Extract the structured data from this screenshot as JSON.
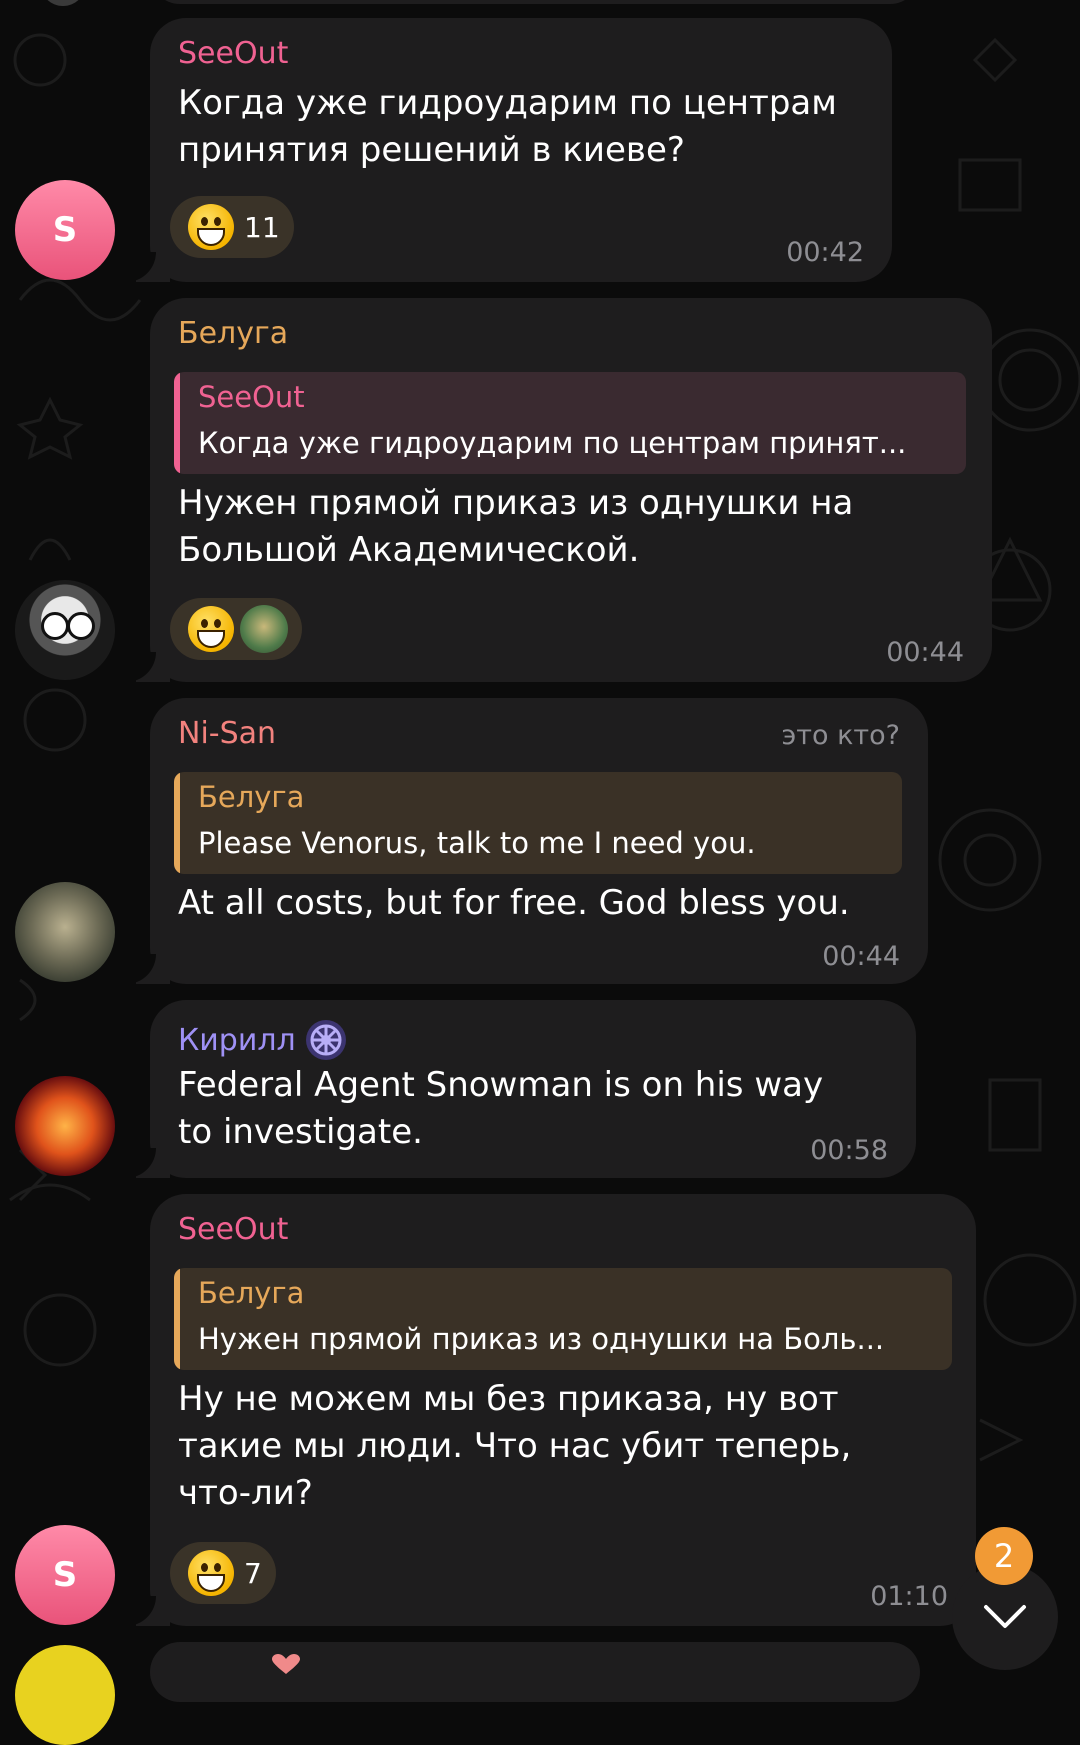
{
  "messages": [
    {
      "sender": "SeeOut",
      "sender_color": "#f06292",
      "avatar_letter": "S",
      "text_lines": [
        "Когда уже гидроударим по центрам",
        "принятия решений в киеве?"
      ],
      "reaction_count": "11",
      "time": "00:42"
    },
    {
      "sender": "Белуга",
      "sender_color": "#e6a85a",
      "reply": {
        "name": "SeeOut",
        "text": "Когда уже гидроударим по центрам принят...",
        "color": "#f06292"
      },
      "text_lines": [
        "Нужен прямой приказ из однушки на",
        "Большой Академической."
      ],
      "time": "00:44"
    },
    {
      "sender": "Ni-San",
      "sender_color": "#f2827e",
      "admin_title": "это кто?",
      "reply": {
        "name": "Белуга",
        "text": "Please Venorus, talk to me I need you.",
        "color": "#e6a85a"
      },
      "text_lines": [
        "At all costs, but for free. God bless you."
      ],
      "time": "00:44"
    },
    {
      "sender": "Кирилл",
      "sender_color": "#9f91f5",
      "text_lines": [
        "Federal Agent Snowman is on his way",
        "to investigate."
      ],
      "time": "00:58"
    },
    {
      "sender": "SeeOut",
      "sender_color": "#f06292",
      "avatar_letter": "S",
      "reply": {
        "name": "Белуга",
        "text": "Нужен прямой приказ из однушки на Боль...",
        "color": "#e6a85a"
      },
      "text_lines": [
        "Ну не можем мы без приказа, ну вот",
        "такие мы люди. Что нас убит теперь,",
        "что-ли?"
      ],
      "reaction_count": "7",
      "time": "01:10"
    }
  ],
  "scroll_down": {
    "unread_count": "2",
    "icon": "chevron-down-icon"
  },
  "colors": {
    "bubble": "#1e1d1e",
    "background": "#0b0b0b",
    "time": "#8e8e93",
    "badge": "#f19a35"
  }
}
